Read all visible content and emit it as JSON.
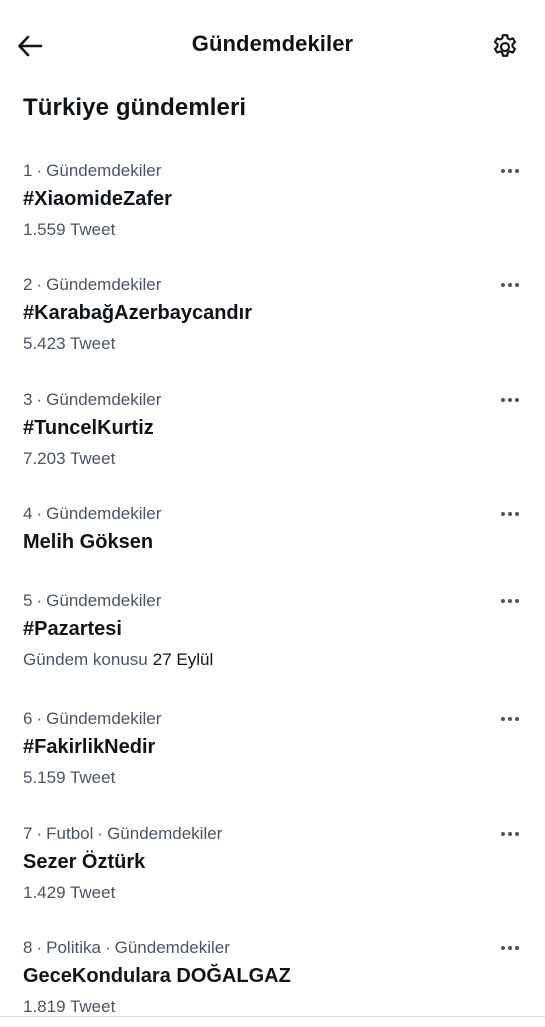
{
  "header": {
    "title": "Gündemdekiler"
  },
  "section": {
    "title": "Türkiye gündemleri"
  },
  "trends": [
    {
      "meta": [
        "1",
        "Gündemdekiler"
      ],
      "name": "#XiaomideZafer",
      "sub": "1.559 Tweet"
    },
    {
      "meta": [
        "2",
        "Gündemdekiler"
      ],
      "name": "#KarabağAzerbaycandır",
      "sub": "5.423 Tweet"
    },
    {
      "meta": [
        "3",
        "Gündemdekiler"
      ],
      "name": "#TuncelKurtiz",
      "sub": "7.203 Tweet"
    },
    {
      "meta": [
        "4",
        "Gündemdekiler"
      ],
      "name": "Melih Göksen",
      "sub": ""
    },
    {
      "meta": [
        "5",
        "Gündemdekiler"
      ],
      "name": "#Pazartesi",
      "sub": "Gündem konusu",
      "sub_date": "27 Eylül"
    },
    {
      "meta": [
        "6",
        "Gündemdekiler"
      ],
      "name": "#FakirlikNedir",
      "sub": "5.159 Tweet"
    },
    {
      "meta": [
        "7",
        "Futbol",
        "Gündemdekiler"
      ],
      "name": "Sezer Öztürk",
      "sub": "1.429 Tweet"
    },
    {
      "meta": [
        "8",
        "Politika",
        "Gündemdekiler"
      ],
      "name": "GeceKondulara DOĞALGAZ",
      "sub": "1.819 Tweet"
    }
  ],
  "icons": {
    "back": "back-arrow-icon",
    "settings": "gear-icon",
    "more": "more-horizontal-icon"
  }
}
